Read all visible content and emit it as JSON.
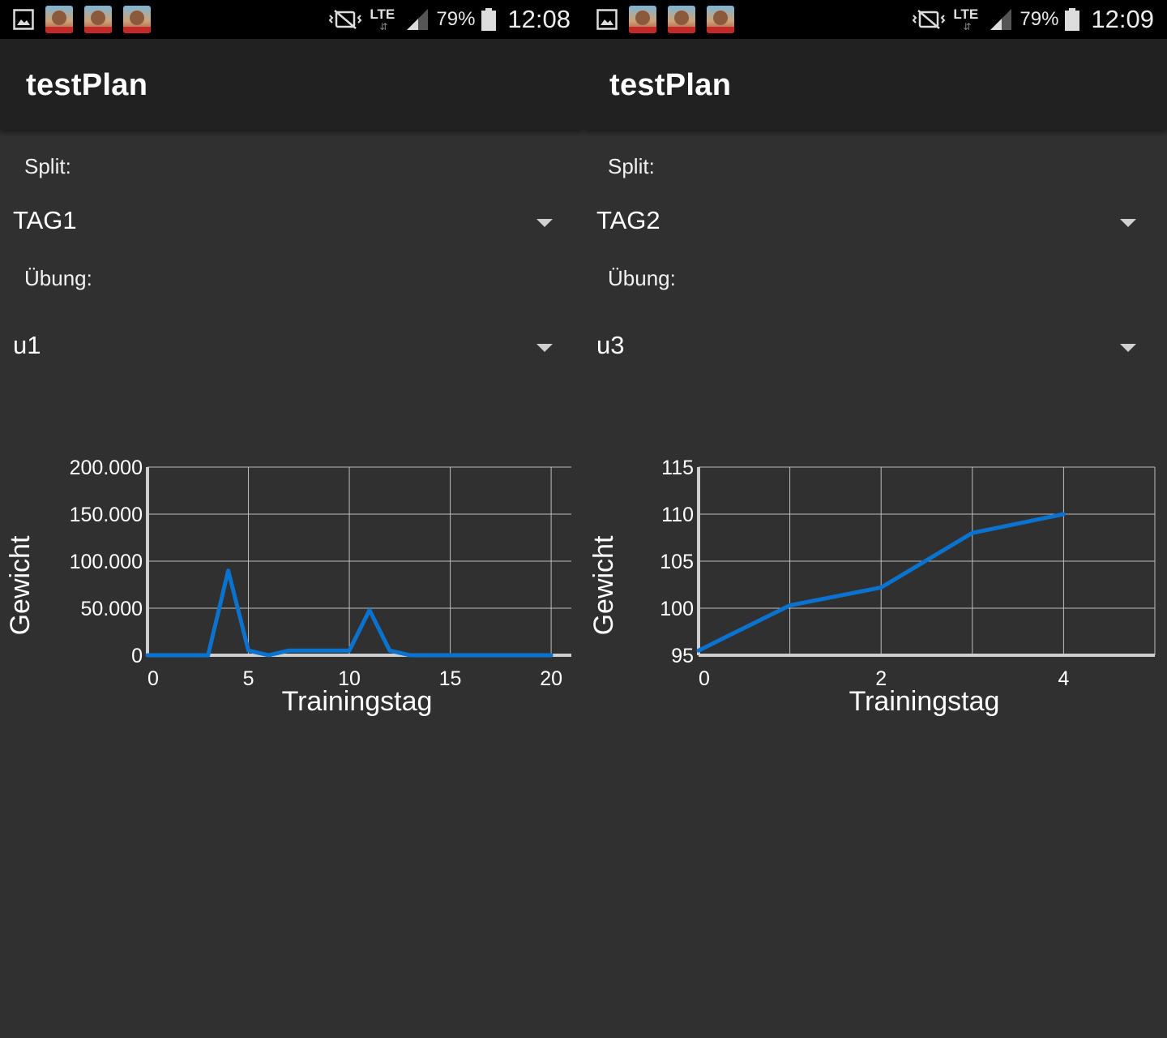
{
  "screens": [
    {
      "status_bar": {
        "battery_percent": "79%",
        "time": "12:08",
        "network": "LTE"
      },
      "app_title": "testPlan",
      "split_label": "Split:",
      "split_value": "TAG1",
      "exercise_label": "Übung:",
      "exercise_value": "u1",
      "chart_data": {
        "type": "line",
        "xlabel": "Trainingstag",
        "ylabel": "Gewicht",
        "xlim": [
          0,
          21
        ],
        "ylim": [
          0,
          200000
        ],
        "x_ticks": [
          0,
          5,
          10,
          15,
          20
        ],
        "x_tick_labels": [
          "0",
          "5",
          "10",
          "15",
          "20"
        ],
        "y_ticks": [
          0,
          50000,
          100000,
          150000,
          200000
        ],
        "y_tick_labels": [
          "0",
          "50.000",
          "100.000",
          "150.000",
          "200.000"
        ],
        "grid": true,
        "line_color": "#0a73d0",
        "series": [
          {
            "x": [
              0,
              1,
              2,
              3,
              4,
              5,
              6,
              7,
              8,
              9,
              10,
              11,
              12,
              13,
              14,
              15,
              16,
              17,
              18,
              19,
              20
            ],
            "y": [
              0,
              0,
              0,
              0,
              90000,
              5000,
              0,
              5000,
              5000,
              5000,
              5000,
              48000,
              5000,
              0,
              0,
              0,
              0,
              0,
              0,
              0,
              0
            ]
          }
        ]
      }
    },
    {
      "status_bar": {
        "battery_percent": "79%",
        "time": "12:09",
        "network": "LTE"
      },
      "app_title": "testPlan",
      "split_label": "Split:",
      "split_value": "TAG2",
      "exercise_label": "Übung:",
      "exercise_value": "u3",
      "chart_data": {
        "type": "line",
        "xlabel": "Trainingstag",
        "ylabel": "Gewicht",
        "xlim": [
          0,
          5
        ],
        "ylim": [
          95,
          115
        ],
        "x_ticks": [
          0,
          2,
          4
        ],
        "x_tick_labels": [
          "0",
          "2",
          "4"
        ],
        "x_grid": [
          0,
          1,
          2,
          3,
          4,
          5
        ],
        "y_ticks": [
          95,
          100,
          105,
          110,
          115
        ],
        "y_tick_labels": [
          "95",
          "100",
          "105",
          "110",
          "115"
        ],
        "grid": true,
        "line_color": "#0a73d0",
        "series": [
          {
            "x": [
              0,
              1,
              2,
              3,
              4
            ],
            "y": [
              95.5,
              100.3,
              102.2,
              108,
              110
            ]
          }
        ]
      }
    }
  ]
}
